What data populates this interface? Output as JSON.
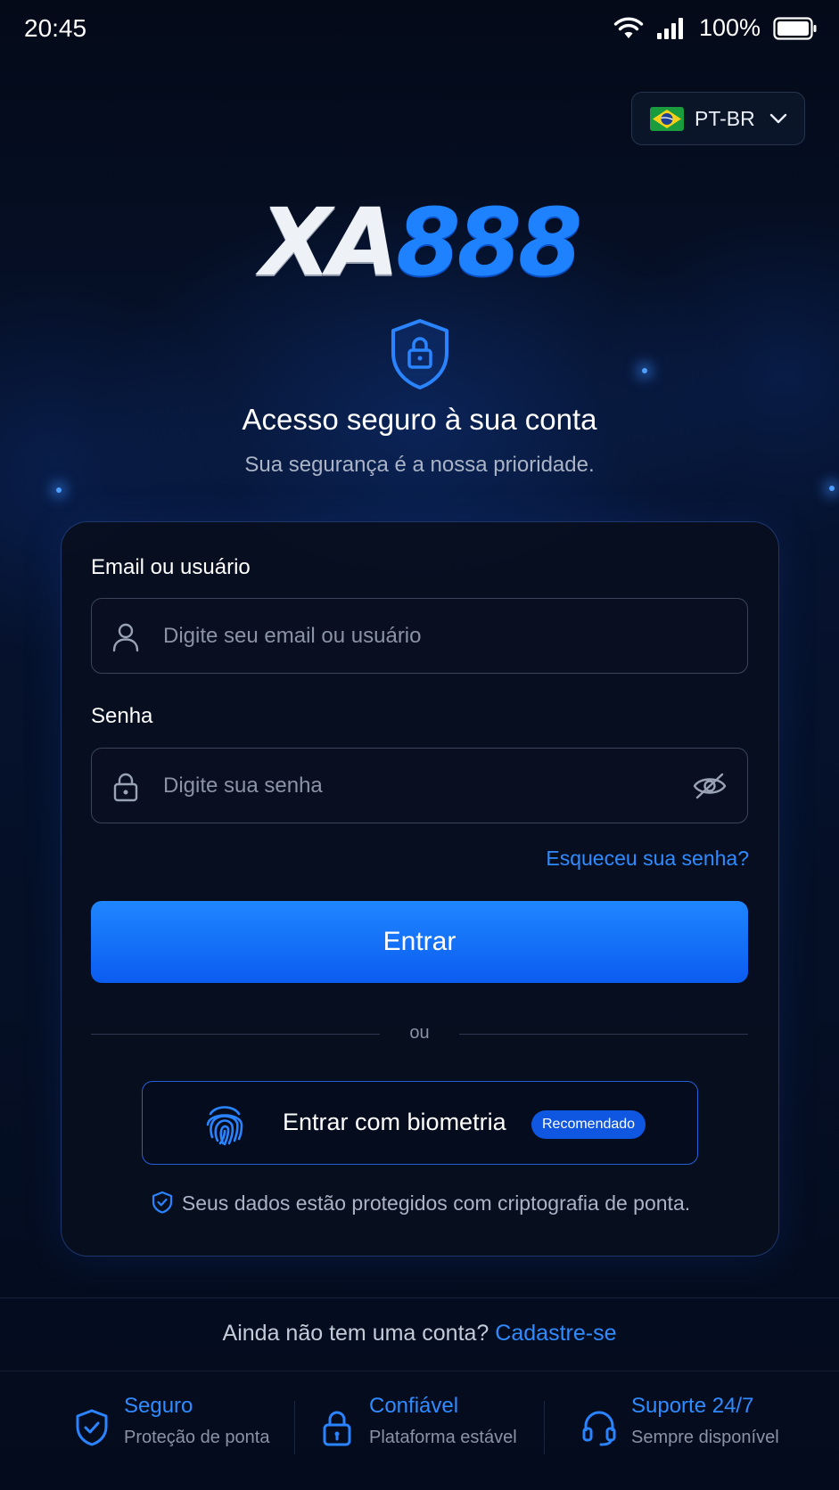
{
  "status_bar": {
    "time": "20:45",
    "battery_percent": "100%",
    "icons": [
      "wifi-icon",
      "cellular-signal-icon",
      "battery-icon"
    ]
  },
  "language": {
    "label": "PT-BR",
    "flag_icon": "brazil-flag-icon"
  },
  "logo": {
    "part1": "XA",
    "part2": "888"
  },
  "hero": {
    "title": "Acesso seguro à sua conta",
    "subtitle": "Sua segurança é a nossa prioridade."
  },
  "form": {
    "email_label": "Email ou usuário",
    "email_placeholder": "Digite seu email ou usuário",
    "email_value": "",
    "password_label": "Senha",
    "password_placeholder": "Digite sua senha",
    "password_value": "",
    "forgot_link": "Esqueceu sua senha?",
    "submit_label": "Entrar",
    "divider_text": "ou",
    "biometric_label": "Entrar com biometria",
    "biometric_badge": "Recomendado",
    "security_note": "Seus dados estão protegidos com criptografia de ponta."
  },
  "signup": {
    "prompt": "Ainda não tem uma conta?",
    "link": "Cadastre-se"
  },
  "features": [
    {
      "title": "Seguro",
      "subtitle": "Proteção de ponta",
      "icon": "shield-check-icon"
    },
    {
      "title": "Confiável",
      "subtitle": "Plataforma estável",
      "icon": "lock-icon"
    },
    {
      "title": "Suporte 24/7",
      "subtitle": "Sempre disponível",
      "icon": "headset-icon"
    }
  ],
  "colors": {
    "accent": "#1e82ff",
    "background": "#040b1a",
    "link": "#2f8bff"
  }
}
